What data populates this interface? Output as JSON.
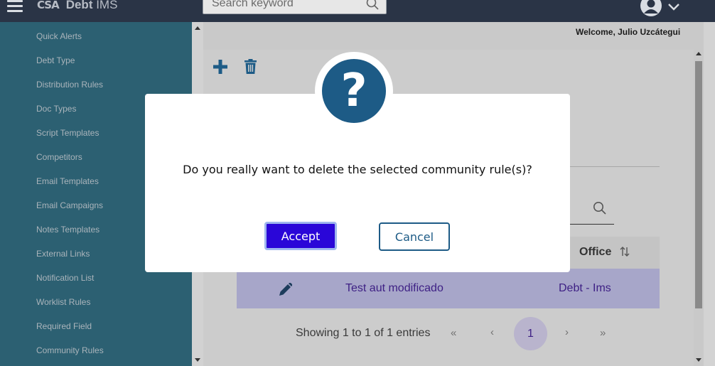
{
  "app": {
    "logo_mark": "CSA",
    "name_bold": "Debt",
    "name_rest": " IMS"
  },
  "search": {
    "placeholder": "Search keyword"
  },
  "header": {
    "welcome": "Welcome, Julio Uzcátegui"
  },
  "sidebar": {
    "items": [
      {
        "label": "Quick Alerts"
      },
      {
        "label": "Debt Type"
      },
      {
        "label": "Distribution Rules"
      },
      {
        "label": "Doc Types"
      },
      {
        "label": "Script Templates"
      },
      {
        "label": "Competitors"
      },
      {
        "label": "Email Templates"
      },
      {
        "label": "Email Campaigns"
      },
      {
        "label": "Notes Templates"
      },
      {
        "label": "External Links"
      },
      {
        "label": "Notification List"
      },
      {
        "label": "Worklist Rules"
      },
      {
        "label": "Required Field"
      },
      {
        "label": "Community Rules"
      }
    ]
  },
  "table": {
    "columns": [
      {
        "label": "Office"
      }
    ],
    "rows": [
      {
        "name": "Test aut modificado",
        "office": "Debt - Ims"
      }
    ]
  },
  "pagination": {
    "summary": "Showing 1 to 1 of 1 entries",
    "first": "«",
    "prev": "‹",
    "current": "1",
    "next": "›",
    "last": "»"
  },
  "dialog": {
    "icon": "?",
    "message": "Do you really want to delete the selected community rule(s)?",
    "accept_label": "Accept",
    "cancel_label": "Cancel"
  },
  "colors": {
    "topbar": "#2a3446",
    "sidebar": "#2c6072",
    "accent": "#2a06d8",
    "brand_blue": "#1d5b86",
    "link": "#3d1f84"
  }
}
